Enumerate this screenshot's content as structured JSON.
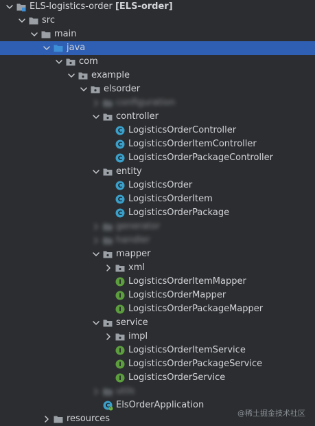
{
  "project": {
    "module_name": "ELS-logistics-order",
    "module_tag": "[ELS-order]"
  },
  "tree": {
    "src": "src",
    "main": "main",
    "java": "java",
    "com": "com",
    "example": "example",
    "elsorder": "elsorder",
    "configuration": "configuration",
    "controller": "controller",
    "controller_classes": [
      "LogisticsOrderController",
      "LogisticsOrderItemController",
      "LogisticsOrderPackageController"
    ],
    "entity": "entity",
    "entity_classes": [
      "LogisticsOrder",
      "LogisticsOrderItem",
      "LogisticsOrderPackage"
    ],
    "generator": "generator",
    "handler": "handler",
    "mapper": "mapper",
    "xml": "xml",
    "mapper_interfaces": [
      "LogisticsOrderItemMapper",
      "LogisticsOrderMapper",
      "LogisticsOrderPackageMapper"
    ],
    "service": "service",
    "impl": "impl",
    "service_interfaces": [
      "LogisticsOrderItemService",
      "LogisticsOrderPackageService",
      "LogisticsOrderService"
    ],
    "utils": "utils",
    "application": "ElsOrderApplication",
    "resources": "resources"
  },
  "watermark": "@稀土掘金技术社区",
  "colors": {
    "background": "#2b2d30",
    "selection": "#2f5fb3",
    "text": "#d2d4d8",
    "folder": "#9aa0a6",
    "source_folder": "#3d8fd6",
    "class_icon": "#3a9fc9",
    "interface_icon": "#5c9e3e"
  },
  "icons": {
    "module": "module-folder-icon",
    "folder": "folder-icon",
    "source_folder": "source-folder-icon",
    "package": "package-icon",
    "class": "class-icon",
    "interface": "interface-icon",
    "spring_boot_app": "spring-boot-application-icon",
    "expanded": "chevron-down-icon",
    "collapsed": "chevron-right-icon"
  }
}
